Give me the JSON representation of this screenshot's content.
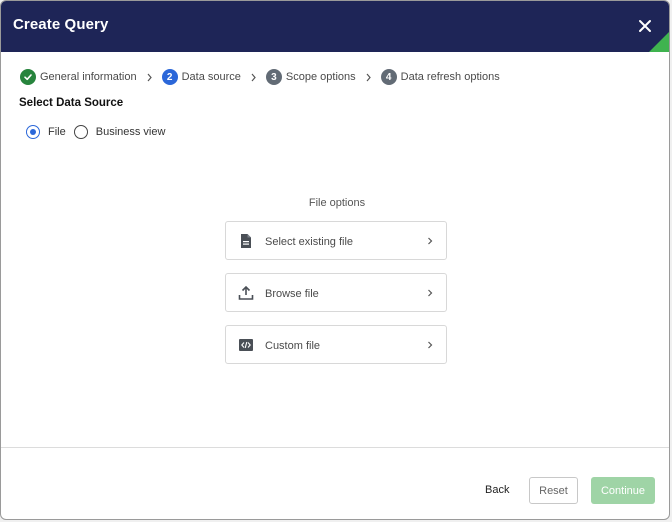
{
  "dialog": {
    "title": "Create Query"
  },
  "steps": [
    {
      "number": "",
      "label": "General information",
      "state": "done"
    },
    {
      "number": "2",
      "label": "Data source",
      "state": "active"
    },
    {
      "number": "3",
      "label": "Scope options",
      "state": "todo"
    },
    {
      "number": "4",
      "label": "Data refresh options",
      "state": "todo"
    }
  ],
  "section": {
    "title": "Select Data Source"
  },
  "source_options": [
    {
      "label": "File",
      "checked": true
    },
    {
      "label": "Business view",
      "checked": false
    }
  ],
  "file_options": {
    "heading": "File options",
    "items": [
      {
        "label": "Select existing file",
        "icon": "document-icon"
      },
      {
        "label": "Browse file",
        "icon": "upload-icon"
      },
      {
        "label": "Custom file",
        "icon": "code-icon"
      }
    ]
  },
  "footer": {
    "back": "Back",
    "reset": "Reset",
    "continue": "Continue"
  },
  "colors": {
    "header": "#1e2557",
    "accent": "#2b67d9",
    "done": "#27843d",
    "continue_disabled": "#9fd4a6",
    "corner": "#3fb34f"
  }
}
